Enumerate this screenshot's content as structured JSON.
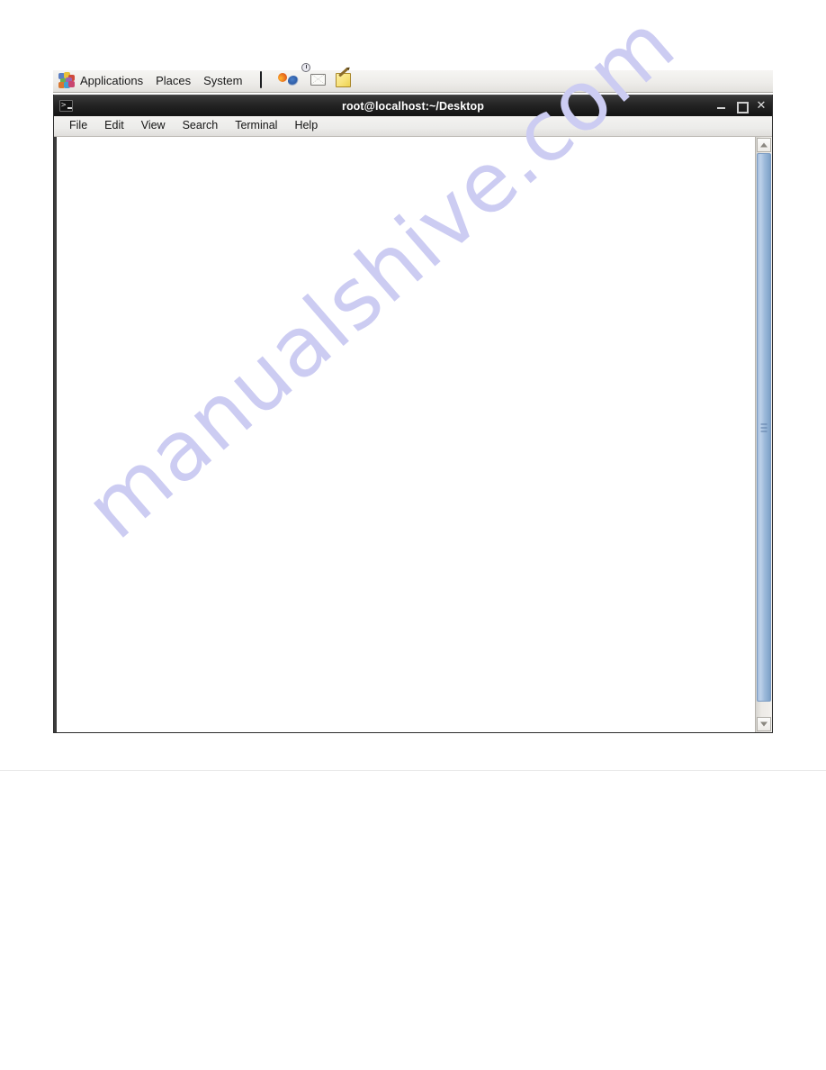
{
  "desktop": {
    "panel": {
      "menus": [
        {
          "label": "Applications",
          "icon": "gnome-applications-icon"
        },
        {
          "label": "Places",
          "icon": "places-icon"
        },
        {
          "label": "System",
          "icon": "system-icon"
        }
      ],
      "launchers": [
        {
          "name": "database-launcher-icon",
          "tooltip": "Database"
        },
        {
          "name": "firefox-launcher-icon",
          "tooltip": "Firefox Web Browser"
        },
        {
          "name": "evolution-mail-launcher-icon",
          "tooltip": "Evolution Mail"
        },
        {
          "name": "text-editor-launcher-icon",
          "tooltip": "Text Editor"
        }
      ]
    }
  },
  "terminal": {
    "titlebar": {
      "icon": "terminal-icon",
      "title": "root@localhost:~/Desktop",
      "controls": {
        "minimize": "_",
        "maximize": "□",
        "close": "✕"
      }
    },
    "menubar": {
      "items": [
        {
          "label": "File"
        },
        {
          "label": "Edit"
        },
        {
          "label": "View"
        },
        {
          "label": "Search"
        },
        {
          "label": "Terminal"
        },
        {
          "label": "Help"
        }
      ]
    },
    "screen": {
      "content": "",
      "background": "#ffffff",
      "foreground": "#000000"
    },
    "scrollbar": {
      "up_arrow": "scroll-up-icon",
      "down_arrow": "scroll-down-icon",
      "thumb_color": "#9dbada"
    }
  },
  "watermark": {
    "text": "manualshive.com",
    "color": "#ccccf2"
  }
}
